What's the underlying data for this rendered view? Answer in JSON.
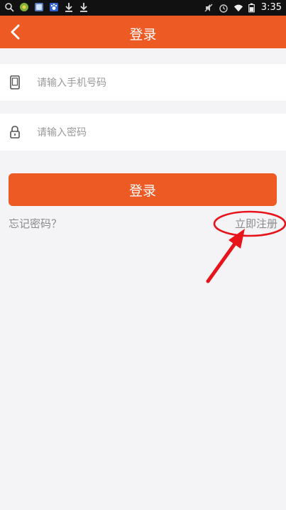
{
  "status_bar": {
    "time": "3:35",
    "left_icons": [
      "search-icon",
      "app-icon",
      "image-icon",
      "paw-icon",
      "download-icon",
      "download-icon"
    ],
    "right_icons": [
      "mute-icon",
      "alarm-icon",
      "wifi-icon",
      "battery-icon"
    ]
  },
  "header": {
    "title": "登录",
    "back_icon": "chevron-left-icon"
  },
  "form": {
    "phone": {
      "value": "",
      "placeholder": "请输入手机号码",
      "icon": "phone-icon"
    },
    "password": {
      "value": "",
      "placeholder": "请输入密码",
      "icon": "lock-icon"
    },
    "login_label": "登录",
    "forgot_label": "忘记密码？",
    "register_label": "立即注册"
  },
  "colors": {
    "accent": "#ee5a24",
    "annotation": "#e8141c",
    "background": "#f4f4f6"
  }
}
